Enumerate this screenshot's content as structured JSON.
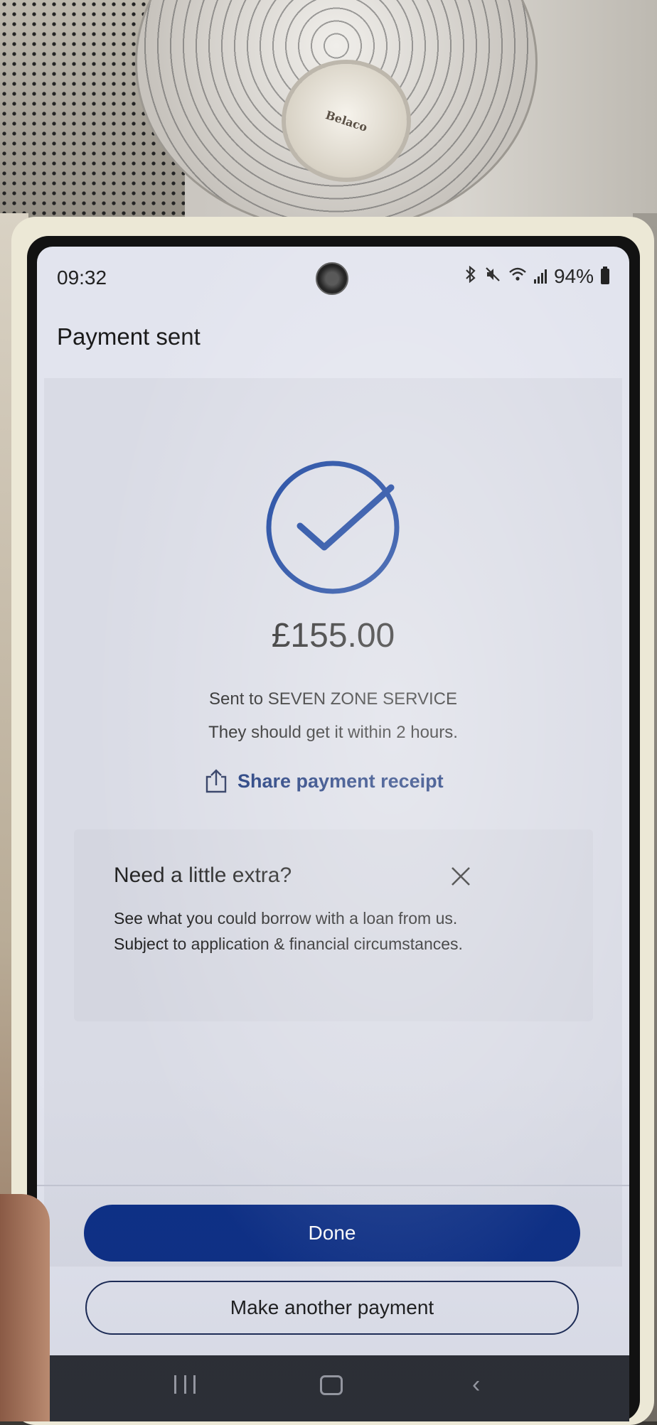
{
  "status_bar": {
    "time": "09:32",
    "battery": "94%"
  },
  "header": {
    "title": "Payment sent"
  },
  "confirmation": {
    "amount": "£155.00",
    "recipient_line": "Sent to SEVEN ZONE SERVICE",
    "eta_line": "They should get it within 2 hours.",
    "share_label": "Share payment receipt"
  },
  "promo": {
    "title": "Need a little extra?",
    "line1": "See what you could borrow with a loan from us.",
    "line2": "Subject to application & financial circumstances."
  },
  "actions": {
    "done_label": "Done",
    "another_label": "Make another payment"
  },
  "background": {
    "fan_brand": "Belaco"
  },
  "colors": {
    "accent": "#0d2f86",
    "link": "#0c2a72",
    "screen_bg": "#e2e4ee"
  }
}
